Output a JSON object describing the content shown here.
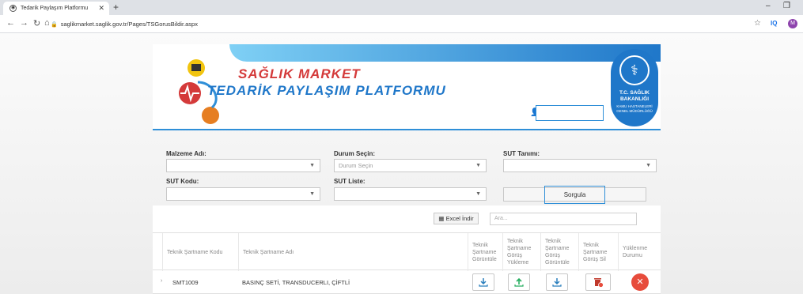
{
  "browser": {
    "tab_title": "Tedarik Paylaşım Platformu",
    "url": "saglikmarket.saglik.gov.tr/Pages/TSGorusBildir.aspx",
    "ext_label": "IQ",
    "profile_initial": "M"
  },
  "header": {
    "brand_line1": "SAĞLIK MARKET",
    "brand_line2": "TEDARİK PAYLAŞIM PLATFORMU",
    "seal_line1": "T.C. SAĞLIK BAKANLIĞI",
    "seal_line2": "KAMU HASTANELERİ GENEL MÜDÜRLÜĞÜ"
  },
  "filters": {
    "malzeme_label": "Malzeme Adı:",
    "durum_label": "Durum Seçin:",
    "durum_placeholder": "Durum Seçin",
    "sut_tanimi_label": "SUT Tanımı:",
    "sut_kodu_label": "SUT Kodu:",
    "sut_liste_label": "SUT Liste:",
    "query_button": "Sorgula"
  },
  "results": {
    "excel_button": "Excel İndir",
    "search_placeholder": "Ara...",
    "columns": [
      "Teknik Şartname Kodu",
      "Teknik Şartname Adı",
      "Teknik Şartname Görüntüle",
      "Teknik Şartname Görüş Yükleme",
      "Teknik Şartname Görüş Görüntüle",
      "Teknik Şartname Görüş Sil",
      "Yüklenme Durumu"
    ],
    "rows": [
      {
        "code": "SMT1009",
        "name": "BASINÇ SETİ, TRANSDUCERLI, ÇİFTLİ"
      }
    ]
  },
  "colors": {
    "accent": "#1f77c9",
    "brand_red": "#d43a3a",
    "danger": "#e74c3c"
  }
}
